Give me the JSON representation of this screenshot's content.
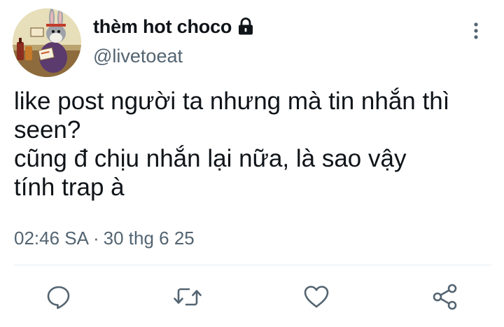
{
  "user": {
    "display_name": "thèm hot choco",
    "handle": "@livetoeat",
    "avatar_icon": "cartoon-bunny-avatar",
    "protected_icon": "lock-icon"
  },
  "tweet": {
    "lines": [
      "like post người ta nhưng mà tin nhắn thì",
      "seen?",
      "cũng đ chịu nhắn lại nữa, là sao vậy",
      "tính trap à"
    ],
    "time": "02:46 SA",
    "separator": "·",
    "date": "30 thg 6 25"
  },
  "actions": {
    "reply_icon": "reply-icon",
    "retweet_icon": "retweet-icon",
    "like_icon": "like-icon",
    "share_icon": "share-icon",
    "more_icon": "more-options-icon"
  },
  "colors": {
    "text_primary": "#0f1419",
    "text_secondary": "#536471",
    "icon": "#536471",
    "divider": "#e6ecf0"
  }
}
